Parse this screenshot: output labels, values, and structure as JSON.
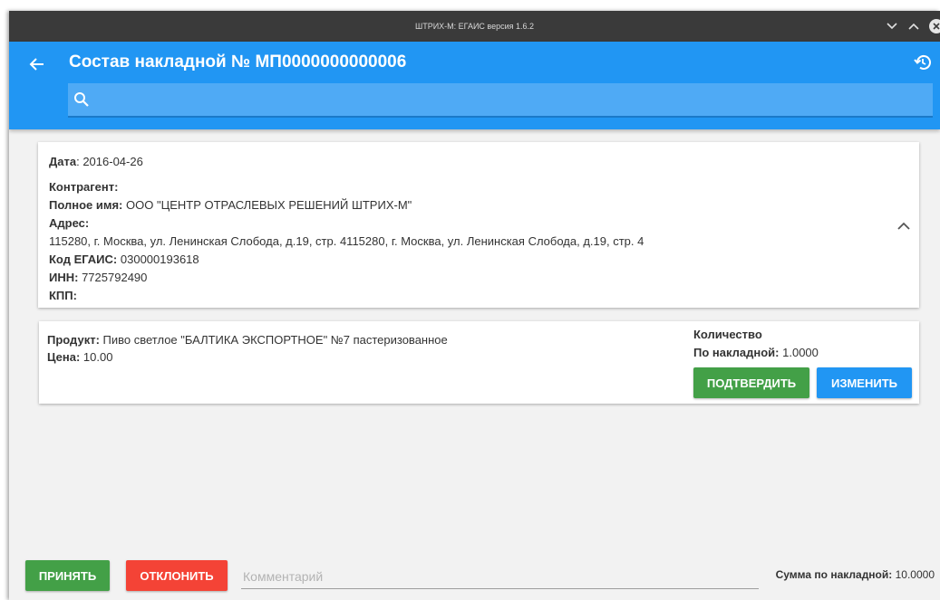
{
  "window": {
    "title": "ШТРИХ-М: ЕГАИС версия 1.6.2"
  },
  "header": {
    "title": "Состав накладной № МП0000000000006"
  },
  "search": {
    "placeholder": ""
  },
  "invoice": {
    "date_label": "Дата",
    "date_value": "2016-04-26",
    "contragent_label": "Контрагент:",
    "fullname_label": "Полное имя:",
    "fullname_value": "ООО \"ЦЕНТР ОТРАСЛЕВЫХ РЕШЕНИЙ ШТРИХ-М\"",
    "address_label": "Адрес:",
    "address_value": "115280, г. Москва, ул. Ленинская Слобода, д.19, стр. 4115280, г. Москва, ул. Ленинская Слобода, д.19, стр. 4",
    "egais_label": "Код ЕГАИС:",
    "egais_value": "030000193618",
    "inn_label": "ИНН:",
    "inn_value": "7725792490",
    "kpp_label": "КПП:",
    "kpp_value": ""
  },
  "product": {
    "product_label": "Продукт:",
    "product_value": "Пиво светлое \"БАЛТИКА ЭКСПОРТНОЕ\" №7 пастеризованное",
    "price_label": "Цена:",
    "price_value": "10.00",
    "qty_label": "Количество",
    "by_invoice_label": "По накладной:",
    "by_invoice_value": "1.0000",
    "confirm_label": "ПОДТВЕРДИТЬ",
    "edit_label": "ИЗМЕНИТЬ"
  },
  "footer": {
    "accept_label": "ПРИНЯТЬ",
    "reject_label": "ОТКЛОНИТЬ",
    "comment_placeholder": "Комментарий",
    "comment_value": "",
    "sum_label": "Сумма по накладной:",
    "sum_value": "10.0000"
  },
  "colors": {
    "appbar": "#2196f3",
    "confirm": "#43a047",
    "reject": "#f44336"
  },
  "icons": [
    "chevron-down-icon",
    "chevron-up-icon",
    "close-icon",
    "back-arrow-icon",
    "history-icon",
    "search-icon",
    "collapse-chevron-icon"
  ]
}
